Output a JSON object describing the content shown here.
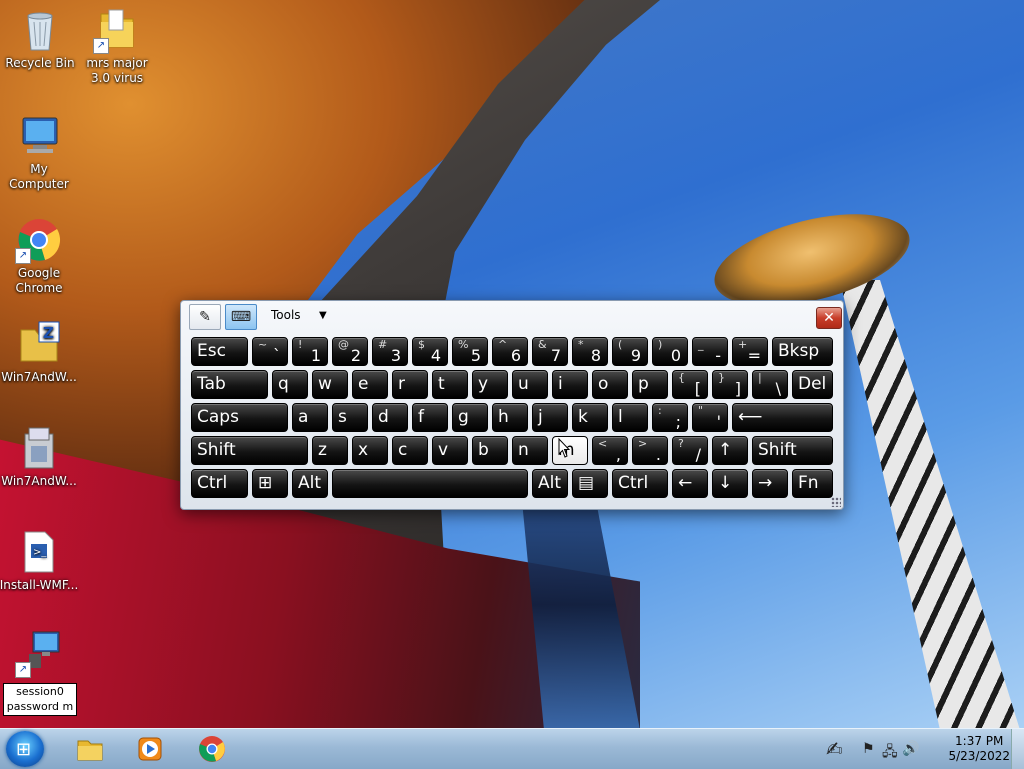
{
  "desktop": {
    "icons": [
      {
        "name": "recycle-bin-icon",
        "label": "Recycle Bin"
      },
      {
        "name": "folder-shortcut-icon",
        "label": "mrs major 3.0 virus"
      },
      {
        "name": "my-computer-icon",
        "label": "My Computer"
      },
      {
        "name": "chrome-icon",
        "label": "Google Chrome"
      },
      {
        "name": "zip-folder-icon",
        "label": "Win7AndW..."
      },
      {
        "name": "installer-icon",
        "label": "Win7AndW..."
      },
      {
        "name": "powershell-script-icon",
        "label": "Install-WMF..."
      }
    ],
    "rename_box": {
      "line1": "session0",
      "line2": "password m"
    }
  },
  "osk": {
    "tools_label": "Tools",
    "close_glyph": "✕",
    "rows": [
      [
        {
          "m": "Esc"
        },
        {
          "s": "~",
          "m": "`"
        },
        {
          "s": "!",
          "m": "1"
        },
        {
          "s": "@",
          "m": "2"
        },
        {
          "s": "#",
          "m": "3"
        },
        {
          "s": "$",
          "m": "4"
        },
        {
          "s": "%",
          "m": "5"
        },
        {
          "s": "^",
          "m": "6"
        },
        {
          "s": "&",
          "m": "7"
        },
        {
          "s": "*",
          "m": "8"
        },
        {
          "s": "(",
          "m": "9"
        },
        {
          "s": ")",
          "m": "0"
        },
        {
          "s": "_",
          "m": "-"
        },
        {
          "s": "+",
          "m": "="
        },
        {
          "m": "Bksp"
        }
      ],
      [
        {
          "m": "Tab"
        },
        {
          "m": "q"
        },
        {
          "m": "w"
        },
        {
          "m": "e"
        },
        {
          "m": "r"
        },
        {
          "m": "t"
        },
        {
          "m": "y"
        },
        {
          "m": "u"
        },
        {
          "m": "i"
        },
        {
          "m": "o"
        },
        {
          "m": "p"
        },
        {
          "s": "{",
          "m": "["
        },
        {
          "s": "}",
          "m": "]"
        },
        {
          "s": "|",
          "m": "\\"
        },
        {
          "m": "Del"
        }
      ],
      [
        {
          "m": "Caps"
        },
        {
          "m": "a"
        },
        {
          "m": "s"
        },
        {
          "m": "d"
        },
        {
          "m": "f"
        },
        {
          "m": "g"
        },
        {
          "m": "h"
        },
        {
          "m": "j"
        },
        {
          "m": "k"
        },
        {
          "m": "l"
        },
        {
          "s": ":",
          "m": ";"
        },
        {
          "s": "\"",
          "m": "'"
        },
        {
          "m": "⟵"
        }
      ],
      [
        {
          "m": "Shift"
        },
        {
          "m": "z"
        },
        {
          "m": "x"
        },
        {
          "m": "c"
        },
        {
          "m": "v"
        },
        {
          "m": "b"
        },
        {
          "m": "n"
        },
        {
          "m": "m"
        },
        {
          "s": "<",
          "m": ","
        },
        {
          "s": ">",
          "m": "."
        },
        {
          "s": "?",
          "m": "/"
        },
        {
          "m": "↑"
        },
        {
          "m": "Shift"
        }
      ],
      [
        {
          "m": "Ctrl"
        },
        {
          "m": "⊞"
        },
        {
          "m": "Alt"
        },
        {
          "m": ""
        },
        {
          "m": "Alt"
        },
        {
          "m": "▤"
        },
        {
          "m": "Ctrl"
        },
        {
          "m": "←"
        },
        {
          "m": "↓"
        },
        {
          "m": "→"
        },
        {
          "m": "Fn"
        }
      ]
    ],
    "hover_key": "m"
  },
  "taskbar": {
    "clock_time": "1:37 PM",
    "clock_date": "5/23/2022"
  }
}
